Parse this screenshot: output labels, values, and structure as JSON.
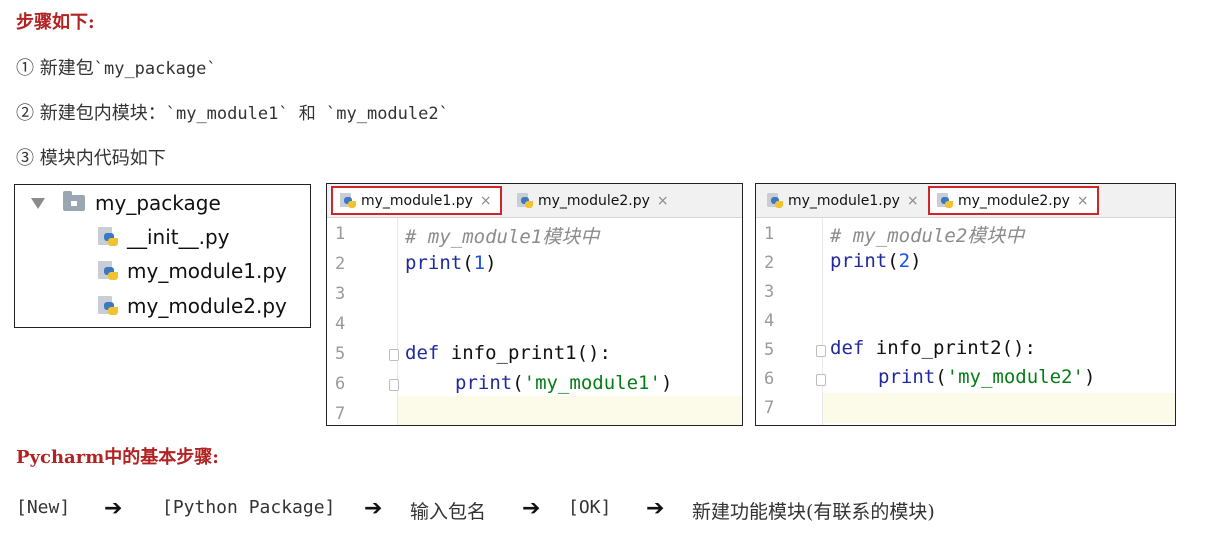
{
  "heading_steps": "步骤如下:",
  "steps": [
    {
      "text": "① 新建包",
      "code": "`my_package`"
    },
    {
      "text": "② 新建包内模块：",
      "code": "`my_module1` 和 `my_module2`"
    },
    {
      "text": "③ 模块内代码如下",
      "code": ""
    }
  ],
  "tree": {
    "folder": "my_package",
    "files": [
      "__init__.py",
      "my_module1.py",
      "my_module2.py"
    ]
  },
  "editor1": {
    "tabs": [
      "my_module1.py",
      "my_module2.py"
    ],
    "active_tab": 0,
    "line_numbers": [
      "1",
      "2",
      "3",
      "4",
      "5",
      "6",
      "7"
    ],
    "comment": "# my_module1模块中",
    "print_fn": "print",
    "print_arg": "1",
    "def_kw": "def",
    "func_sig": " info_print1():",
    "inner_print": "print",
    "inner_str": "'my_module1'"
  },
  "editor2": {
    "tabs": [
      "my_module1.py",
      "my_module2.py"
    ],
    "active_tab": 1,
    "line_numbers": [
      "1",
      "2",
      "3",
      "4",
      "5",
      "6",
      "7"
    ],
    "comment": "# my_module2模块中",
    "print_fn": "print",
    "print_arg": "2",
    "def_kw": "def",
    "func_sig": " info_print2():",
    "inner_print": "print",
    "inner_str": "'my_module2'"
  },
  "tab_close_glyph": "×",
  "heading_pycharm": "Pycharm中的基本步骤:",
  "flow": [
    "[New]",
    "[Python Package]",
    "输入包名",
    "[OK]",
    "新建功能模块(有联系的模块)"
  ],
  "arrow_glyph": "➔",
  "colors": {
    "heading": "#b22222",
    "active_tab_border": "#d0252a",
    "keyword": "#1f2aa0",
    "string": "#067d17",
    "number": "#1750eb"
  }
}
